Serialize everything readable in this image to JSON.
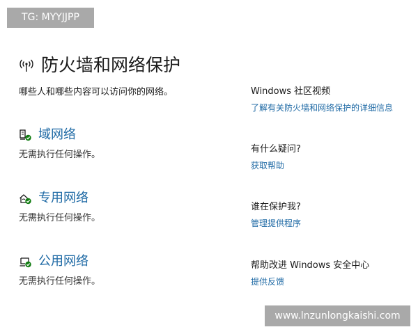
{
  "overlays": {
    "tag": "TG: MYYJJPP",
    "url": "www.lnzunlongkaishi.com"
  },
  "header": {
    "title": "防火墙和网络保护",
    "subtitle": "哪些人和哪些内容可以访问你的网络。",
    "icon": "wireless-signal-icon"
  },
  "networks": [
    {
      "icon": "domain-network-icon",
      "name": "域网络",
      "status": "无需执行任何操作。"
    },
    {
      "icon": "private-network-icon",
      "name": "专用网络",
      "status": "无需执行任何操作。"
    },
    {
      "icon": "public-network-icon",
      "name": "公用网络",
      "status": "无需执行任何操作。"
    }
  ],
  "sidebar": [
    {
      "heading": "Windows 社区视频",
      "link": "了解有关防火墙和网络保护的详细信息"
    },
    {
      "heading": "有什么疑问?",
      "link": "获取帮助"
    },
    {
      "heading": "谁在保护我?",
      "link": "管理提供程序"
    },
    {
      "heading": "帮助改进 Windows 安全中心",
      "link": "提供反馈"
    }
  ],
  "colors": {
    "link": "#1f6aa5",
    "check": "#107c10",
    "overlay": "#a9a9a9"
  }
}
